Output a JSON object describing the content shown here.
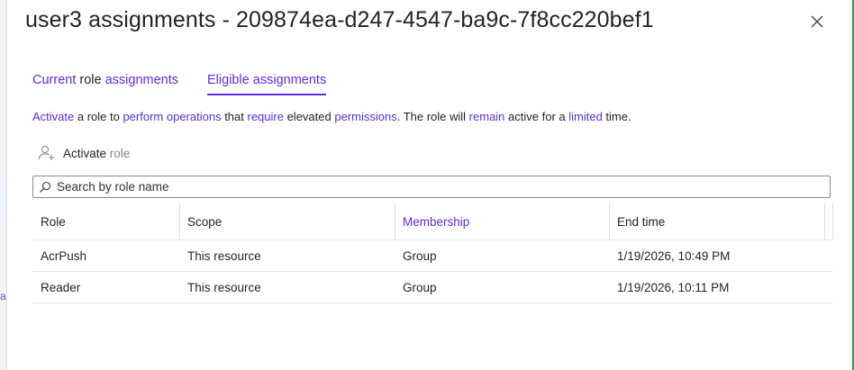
{
  "panel": {
    "title": "user3 assignments - 209874ea-d247-4547-ba9c-7f8cc220bef1",
    "close_icon": "close-icon"
  },
  "background": {
    "left_char": "a"
  },
  "tabs": [
    {
      "label_part1": "Current",
      "label_part2": " role ",
      "label_part3": "assignments",
      "active": false
    },
    {
      "label": "Eligible assignments",
      "active": true
    }
  ],
  "description": {
    "seg1": "Activate",
    "seg2": " a role to ",
    "seg3": "perform operations",
    "seg4": " that ",
    "seg5": "require",
    "seg6": " elevated ",
    "seg7": "permissions",
    "seg8": ". The role will ",
    "seg9": "remain",
    "seg10": " active for a ",
    "seg11": "limited",
    "seg12": " time."
  },
  "toolbar": {
    "activate_label": "Activate",
    "activate_suffix": " role",
    "activate_icon": "person-add-icon"
  },
  "search": {
    "placeholder": "Search by role name",
    "value": "",
    "icon": "search-icon"
  },
  "table": {
    "columns": [
      "Role",
      "Scope",
      "Membership",
      "End time"
    ],
    "rows": [
      [
        "AcrPush",
        "This resource",
        "Group",
        "1/19/2026, 10:49 PM"
      ],
      [
        "Reader",
        "This resource",
        "Group",
        "1/19/2026, 10:11 PM"
      ]
    ]
  },
  "colors": {
    "accent": "#5c2de0",
    "text": "#242424",
    "right_border": "#2e9e4f"
  }
}
